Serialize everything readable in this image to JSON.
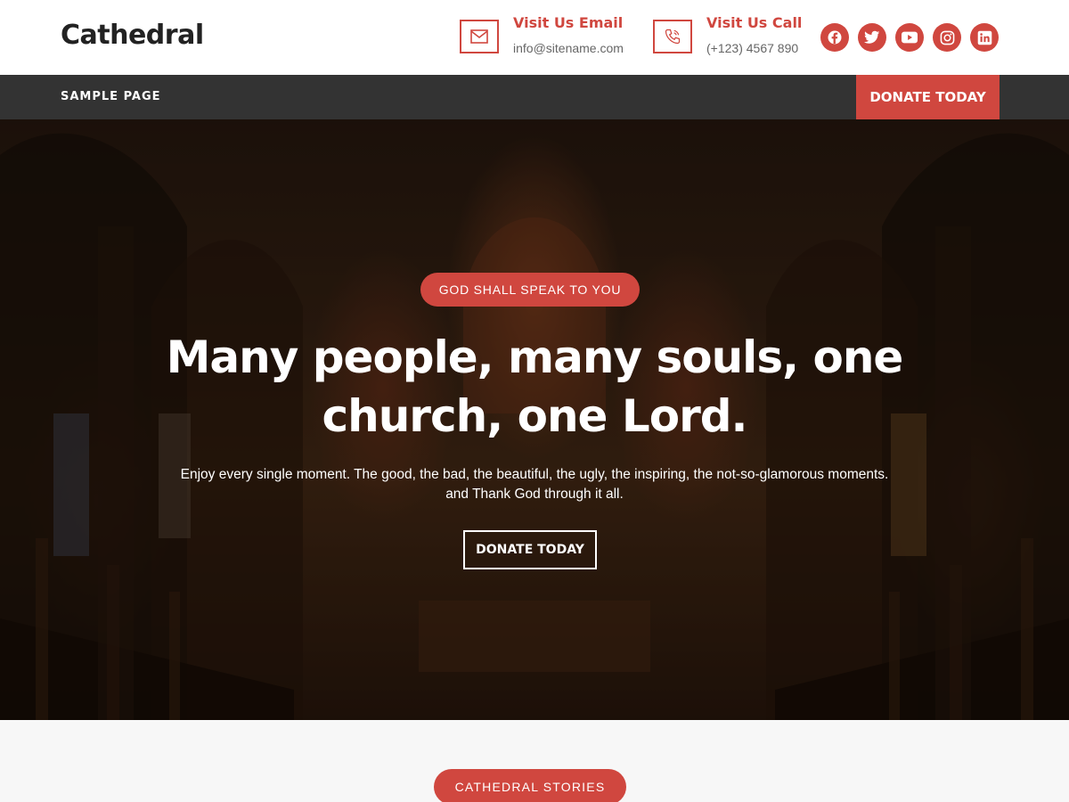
{
  "header": {
    "brand": "Cathedral",
    "email": {
      "title": "Visit Us Email",
      "value": "info@sitename.com",
      "icon": "envelope-icon"
    },
    "call": {
      "title": "Visit Us Call",
      "value": "(+123) 4567 890",
      "icon": "phone-icon"
    },
    "socials": [
      "facebook-icon",
      "twitter-icon",
      "youtube-icon",
      "instagram-icon",
      "linkedin-icon"
    ]
  },
  "nav": {
    "items": [
      {
        "label": "SAMPLE PAGE"
      }
    ],
    "donate_label": "DONATE TODAY"
  },
  "hero": {
    "badge": "GOD SHALL SPEAK TO YOU",
    "title": "Many people, many souls, one church, one Lord.",
    "text_line1": "Enjoy every single moment. The good, the bad, the beautiful, the ugly, the inspiring, the not-so-glamorous moments.",
    "text_line2": "and Thank God through it all.",
    "button": "DONATE TODAY"
  },
  "stories": {
    "badge": "CATHEDRAL STORIES"
  },
  "colors": {
    "accent": "#d0473f",
    "nav_bg": "#333333",
    "section_bg": "#f7f7f7"
  }
}
